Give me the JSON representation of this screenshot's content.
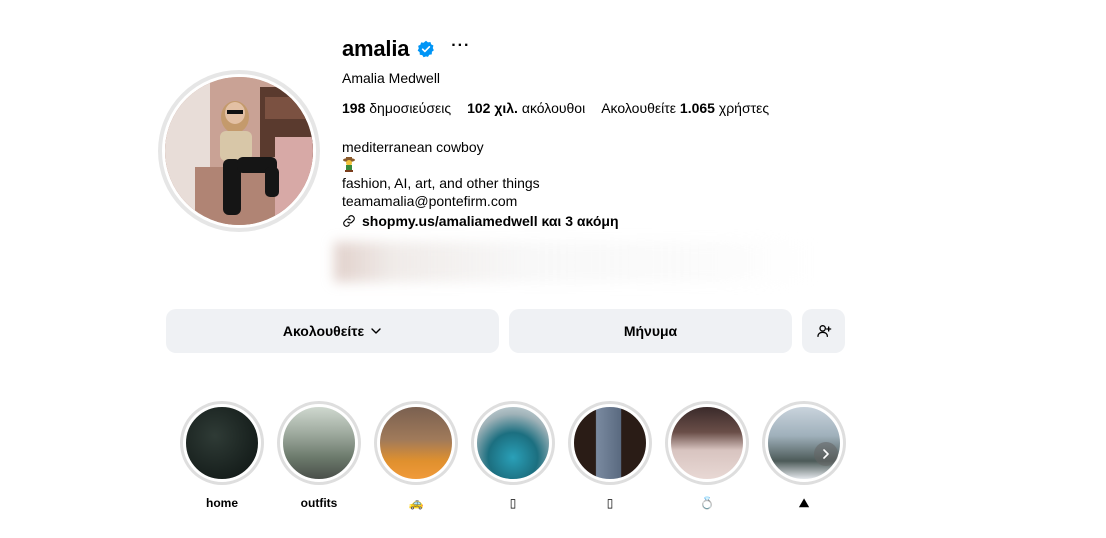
{
  "profile": {
    "username": "amalia",
    "full_name": "Amalia Medwell",
    "more_glyph": "···",
    "stats": {
      "posts_count": "198",
      "posts_label": "δημοσιεύσεις",
      "followers_count": "102 χιλ.",
      "followers_label": "ακόλουθοι",
      "following_prefix": "Ακολουθείτε",
      "following_count": "1.065",
      "following_label": "χρήστες"
    },
    "bio": {
      "line1": "mediterranean cowboy",
      "line3": "fashion, AI, art, and other things",
      "line4": "teamamalia@pontefirm.com",
      "link": "shopmy.us/amaliamedwell και 3 ακόμη"
    }
  },
  "actions": {
    "following_button": "Ακολουθείτε",
    "message_button": "Μήνυμα"
  },
  "highlights": [
    {
      "label": "home"
    },
    {
      "label": "outfits"
    },
    {
      "label": "🚕"
    },
    {
      "label": "▯"
    },
    {
      "label": "▯"
    },
    {
      "label": "💍"
    },
    {
      "label": "⛰"
    }
  ],
  "colors": {
    "verified": "#0095f6",
    "button_bg": "#eff1f4",
    "ring": "#dedede"
  }
}
